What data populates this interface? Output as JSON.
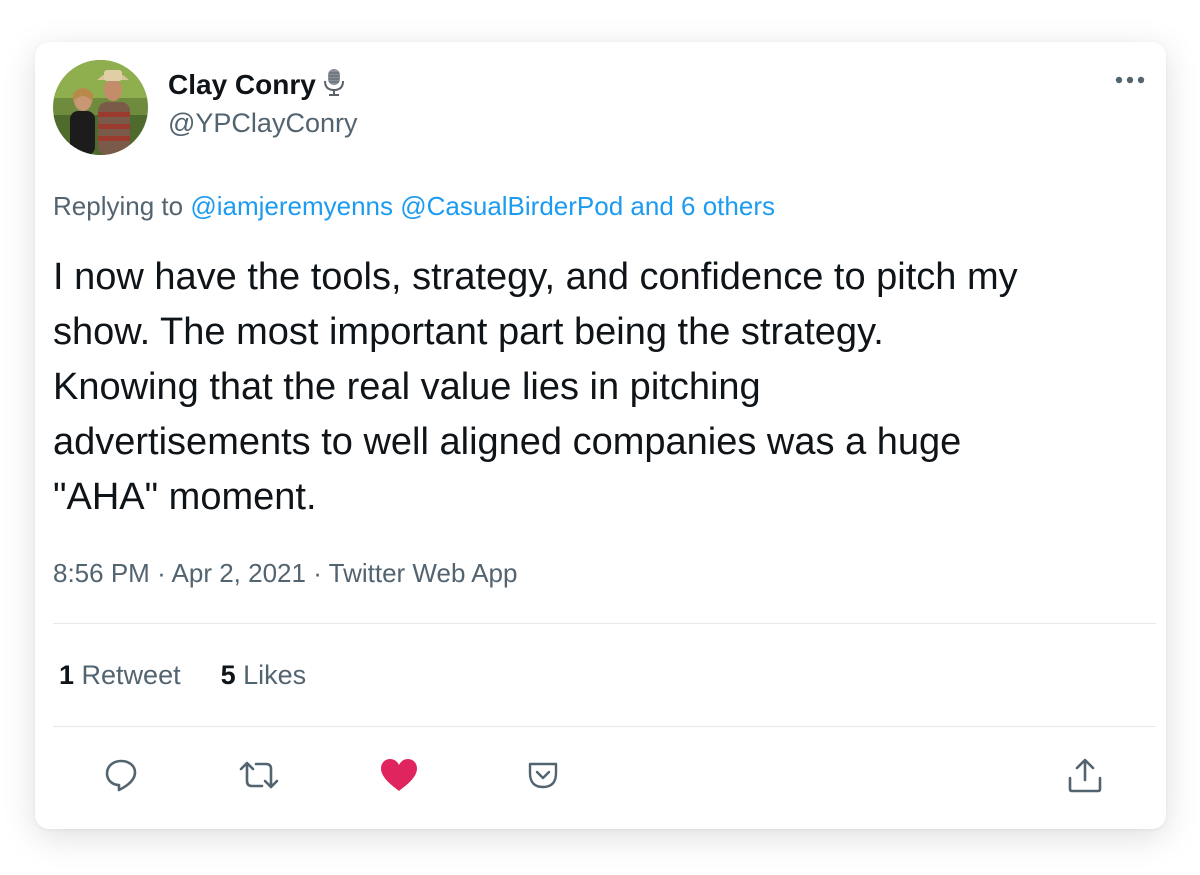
{
  "tweet": {
    "author_name": "Clay Conry",
    "author_handle": "@YPClayConry",
    "replying_prefix": "Replying to",
    "reply_mention_1": "@iamjeremyenns",
    "reply_mention_2": "@CasualBirderPod",
    "reply_others": "and 6 others",
    "text_lines": [
      "I now have the tools, strategy, and confidence to pitch my",
      "show. The most important part being the strategy.",
      "Knowing that the real value lies in pitching",
      "advertisements to well aligned companies was a huge",
      "\"AHA\" moment."
    ],
    "time": "8:56 PM",
    "date": "Apr 2, 2021",
    "source": "Twitter Web App",
    "separator": "·"
  },
  "stats": {
    "retweets_count": "1",
    "retweets_label": "Retweet",
    "likes_count": "5",
    "likes_label": "Likes"
  },
  "icons": {
    "badge": "microphone-icon",
    "more": "more-dots-icon",
    "reply": "reply-icon",
    "retweet": "retweet-icon",
    "like": "heart-icon",
    "bookmark": "bookmark-pocket-icon",
    "share": "share-icon"
  },
  "colors": {
    "text": "#0f1419",
    "muted": "#536471",
    "link": "#1d9bf0",
    "like": "#e0245e",
    "divider": "#e4e9ec"
  }
}
